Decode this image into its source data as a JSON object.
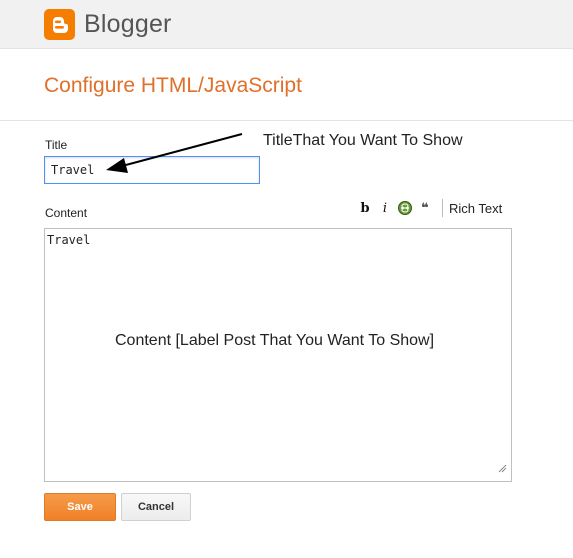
{
  "header": {
    "brand": "Blogger",
    "logo_icon": "blogger-logo-icon",
    "brand_color": "#f57d00"
  },
  "page": {
    "title": "Configure HTML/JavaScript",
    "title_color": "#e0702a"
  },
  "form": {
    "title_label": "Title",
    "title_value": "Travel",
    "content_label": "Content",
    "content_value": "Travel",
    "toolbar": {
      "bold_label": "b",
      "italic_label": "i",
      "link_icon": "link-icon",
      "quote_label": "❝",
      "rich_text_label": "Rich Text"
    },
    "save_label": "Save",
    "cancel_label": "Cancel",
    "save_color": "#f58f3a"
  },
  "annotations": {
    "title_note": "TitleThat You Want To Show",
    "content_note": "Content [Label Post That You Want To Show]"
  }
}
